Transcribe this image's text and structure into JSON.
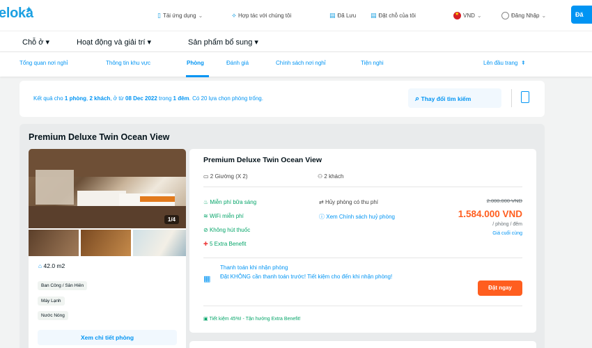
{
  "header": {
    "logo": "eloka",
    "nav": [
      {
        "icon": "phone-icon",
        "label": "Tải ứng dụng"
      },
      {
        "icon": "handshake-icon",
        "label": "Hợp tác với chúng tôi"
      },
      {
        "icon": "bookmark-icon",
        "label": "Đã Lưu"
      },
      {
        "icon": "booking-icon",
        "label": "Đặt chỗ của tôi"
      },
      {
        "icon": "vietnam-flag-icon",
        "label": "VND"
      },
      {
        "icon": "user-icon",
        "label": "Đăng Nhập"
      }
    ],
    "primary_button": "Đă"
  },
  "categories": [
    "Chỗ ở",
    "Hoạt động và giải trí",
    "Sản phẩm bổ sung"
  ],
  "tabs": [
    "Tổng quan nơi nghỉ",
    "Thông tin khu vực",
    "Phòng",
    "Đánh giá",
    "Chính sách nơi nghỉ",
    "Tiện nghi"
  ],
  "active_tab": "Phòng",
  "back_to_top": "Lên đầu trang",
  "result": {
    "prefix": "Kết quả cho ",
    "rooms": "1 phòng",
    "sep1": ", ",
    "guests": "2 khách",
    "mid": ", ở từ ",
    "date": "08 Dec 2022",
    "mid2": " trong ",
    "nights": "1 đêm",
    "suffix": ". Có 20 lựa chọn phòng trống."
  },
  "change_search": "Thay đổi tìm kiếm",
  "room": {
    "title": "Premium Deluxe Twin Ocean View",
    "image_counter": "1/4",
    "area": "42.0 m2",
    "amenities": [
      "Ban Công / Sân Hiên",
      "Máy Lạnh",
      "Nước Nóng"
    ],
    "detail_button": "Xem chi tiết phòng",
    "offer": {
      "title": "Premium Deluxe Twin Ocean View",
      "beds": "2 Giường (X 2)",
      "guests": "2 khách",
      "features": [
        {
          "icon": "breakfast-icon",
          "label": "Miễn phí bữa sáng"
        },
        {
          "icon": "wifi-icon",
          "label": "WiFi miễn phí"
        },
        {
          "icon": "no-smoking-icon",
          "label": "Không hút thuốc"
        },
        {
          "icon": "gift-icon",
          "label": "5 Extra Benefit"
        }
      ],
      "cancel": "Hủy phòng có thu phí",
      "cancel_policy": "Xem Chính sách huỷ phòng",
      "original_price": "2.000.000 VND",
      "price": "1.584.000 VND",
      "per": "/ phòng / đêm",
      "final_price": "Giá cuối cùng",
      "pay_title": "Thanh toán khi nhận phòng",
      "pay_desc": "Đặt KHÔNG cần thanh toán trước! Tiết kiệm cho đến khi nhận phòng!",
      "book_button": "Đặt ngay",
      "saving": "Tiết kiệm 45%! - Tận hưởng Extra Benefit!"
    }
  }
}
